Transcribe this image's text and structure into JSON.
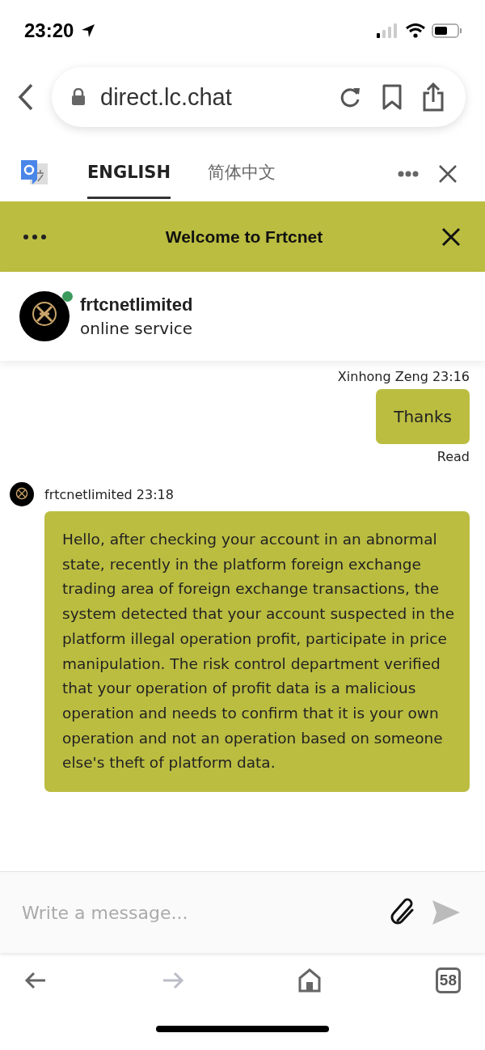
{
  "status_bar": {
    "time": "23:20"
  },
  "address_bar": {
    "url": "direct.lc.chat"
  },
  "translate_bar": {
    "tabs": [
      {
        "label": "ENGLISH",
        "selected": true
      },
      {
        "label": "简体中文",
        "selected": false
      }
    ]
  },
  "chat_header": {
    "title": "Welcome to Frtcnet"
  },
  "agent": {
    "name": "frtcnetlimited",
    "status": "online service",
    "online": true
  },
  "messages": [
    {
      "kind": "outgoing",
      "meta": "Xinhong Zeng 23:16",
      "text": "Thanks",
      "receipt": "Read"
    },
    {
      "kind": "incoming",
      "meta": "frtcnetlimited 23:18",
      "text": "Hello, after checking your account in an abnormal state, recently in the platform foreign exchange trading area of foreign exchange transactions, the system detected that your account suspected in the platform illegal operation profit, participate in price manipulation. The risk control department verified that your operation of profit data is a malicious operation and needs to confirm that it is your own operation and not an operation based on someone else's theft of platform data."
    }
  ],
  "composer": {
    "placeholder": "Write a message..."
  },
  "toolbar": {
    "forward_disabled": true,
    "tab_count": "58"
  }
}
